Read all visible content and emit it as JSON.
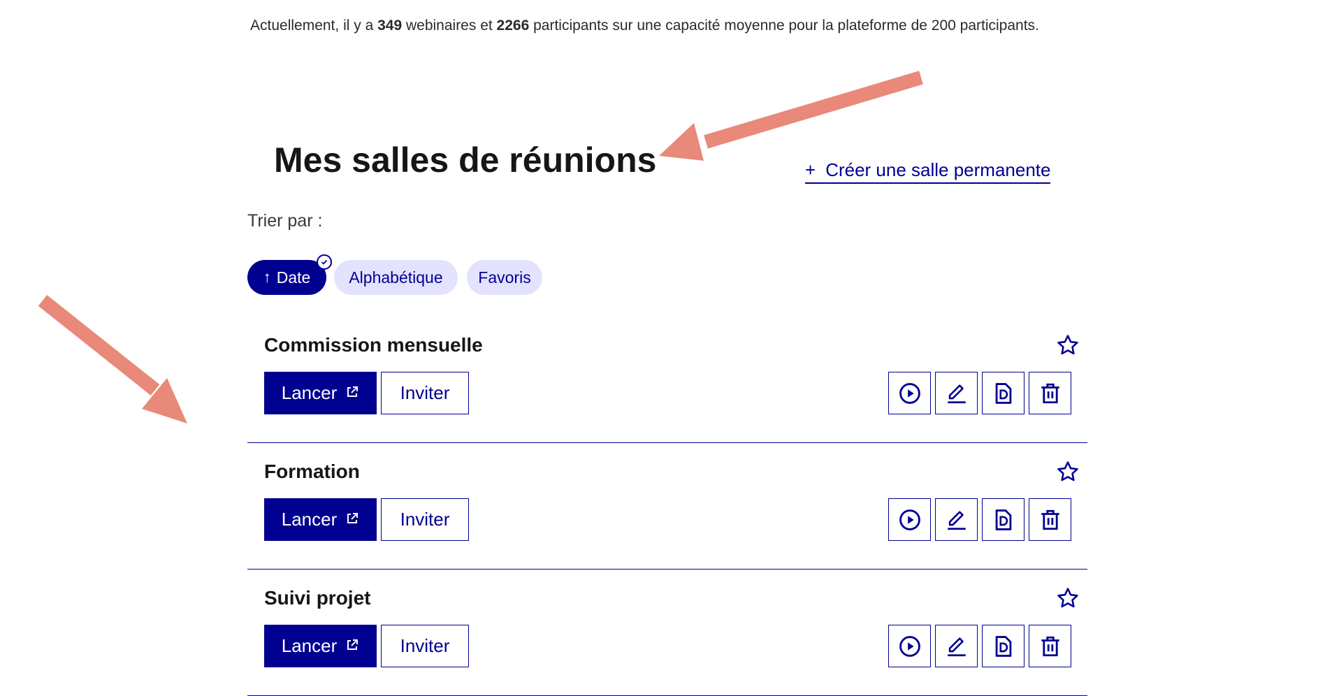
{
  "stats": {
    "prefix": "Actuellement, il y a ",
    "webinars": "349",
    "middle1": " webinaires et ",
    "participants": "2266",
    "suffix": " participants sur une capacité moyenne pour la plateforme de 200 participants."
  },
  "header": {
    "title": "Mes salles de réunions",
    "create_plus": "+",
    "create_label": "Créer une salle permanente"
  },
  "sort": {
    "label": "Trier par :",
    "options": [
      {
        "label": "Date",
        "arrow": "↑",
        "active": true
      },
      {
        "label": "Alphabétique",
        "active": false
      },
      {
        "label": "Favoris",
        "active": false
      }
    ]
  },
  "rooms": [
    {
      "name": "Commission mensuelle",
      "launch_label": "Lancer",
      "invite_label": "Inviter"
    },
    {
      "name": "Formation",
      "launch_label": "Lancer",
      "invite_label": "Inviter"
    },
    {
      "name": "Suivi projet",
      "launch_label": "Lancer",
      "invite_label": "Inviter"
    }
  ],
  "icons": {
    "favorite": "star-outline-icon",
    "launch": "external-link-icon",
    "actions": [
      "play-circle-icon",
      "pencil-icon",
      "document-icon",
      "trash-icon"
    ],
    "sort_active": "check-circle-icon"
  },
  "colors": {
    "primary": "#000091",
    "chip_bg": "#e3e3fd",
    "annotation_arrow": "#e8897a",
    "text": "#161616"
  }
}
